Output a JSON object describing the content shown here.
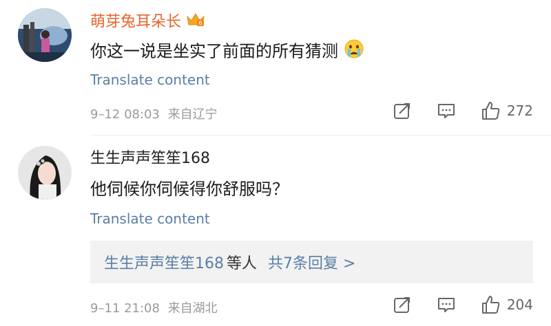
{
  "comments": [
    {
      "username": "萌芽兔耳朵长",
      "username_color": "#e8632c",
      "badge_icon": "crown-vip-icon",
      "text": "你这一说是坐实了前面的所有猜测",
      "emoji": "crying-face-icon",
      "translate": "Translate content",
      "time": "9–12 08:03",
      "location": "来自辽宁",
      "likes": "272"
    },
    {
      "username": "生生声声笙笙168",
      "username_color": "#222222",
      "text": "他伺候你伺候得你舒服吗？",
      "translate": "Translate content",
      "reply_preview": {
        "names": "生生声声笙笙168",
        "suffix": "等人",
        "count_link": "共7条回复 >"
      },
      "time": "9–11 21:08",
      "location": "来自湖北",
      "likes": "204"
    }
  ],
  "colors": {
    "link_blue": "#5b7ea6",
    "meta_gray": "#9a9a9a",
    "reply_bg": "#f2f2f2"
  }
}
